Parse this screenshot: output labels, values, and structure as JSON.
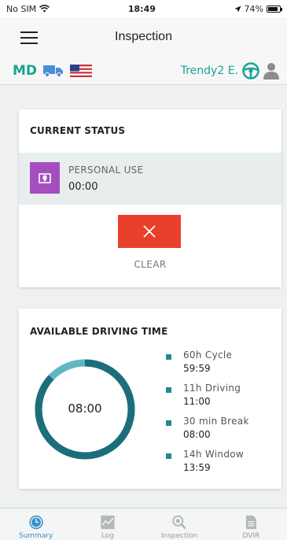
{
  "status_bar": {
    "carrier": "No SIM",
    "time": "18:49",
    "battery": "74%"
  },
  "nav": {
    "title": "Inspection"
  },
  "subbar": {
    "state_code": "MD",
    "driver_name": "Trendy2 E.",
    "accent": "#19a38f"
  },
  "current_status": {
    "title": "CURRENT STATUS",
    "status_label": "PERSONAL USE",
    "status_time": "00:00",
    "clear_label": "CLEAR",
    "status_color": "#a44fc0",
    "clear_color": "#e8402b"
  },
  "driving_time": {
    "title": "AVAILABLE DRIVING TIME",
    "ring_value": "08:00",
    "ring_fraction": 0.87,
    "limits": [
      {
        "name": "60h Cycle",
        "value": "59:59"
      },
      {
        "name": "11h Driving",
        "value": "11:00"
      },
      {
        "name": "30 min Break",
        "value": "08:00"
      },
      {
        "name": "14h Window",
        "value": "13:59"
      }
    ]
  },
  "tabs": [
    {
      "label": "Summary",
      "icon": "clock-icon",
      "active": true
    },
    {
      "label": "Log",
      "icon": "graph-icon",
      "active": false
    },
    {
      "label": "Inspection",
      "icon": "magnifier-icon",
      "active": false
    },
    {
      "label": "DVIR",
      "icon": "document-icon",
      "active": false
    }
  ]
}
